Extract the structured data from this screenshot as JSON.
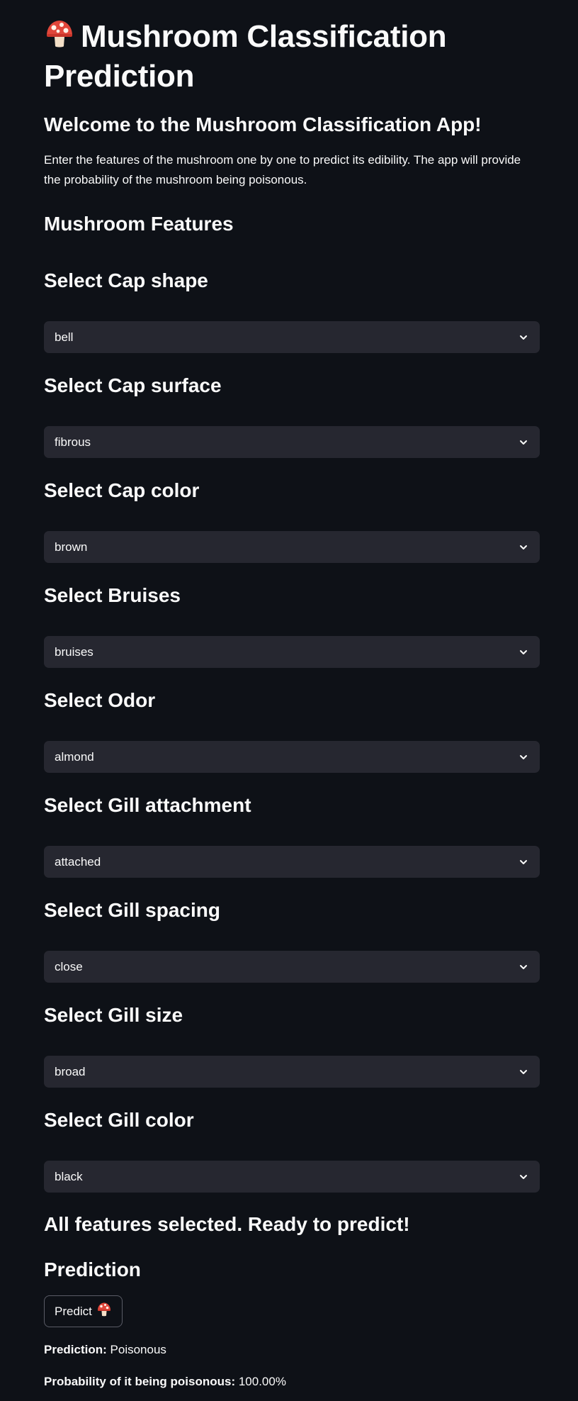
{
  "app": {
    "title_line": "Mushroom Classification Prediction",
    "welcome": "Welcome to the Mushroom Classification App!",
    "intro": "Enter the features of the mushroom one by one to predict its edibility. The app will provide the probability of the mushroom being poisonous.",
    "features_heading": "Mushroom Features"
  },
  "features": [
    {
      "label": "Select Cap shape",
      "value": "bell"
    },
    {
      "label": "Select Cap surface",
      "value": "fibrous"
    },
    {
      "label": "Select Cap color",
      "value": "brown"
    },
    {
      "label": "Select Bruises",
      "value": "bruises"
    },
    {
      "label": "Select Odor",
      "value": "almond"
    },
    {
      "label": "Select Gill attachment",
      "value": "attached"
    },
    {
      "label": "Select Gill spacing",
      "value": "close"
    },
    {
      "label": "Select Gill size",
      "value": "broad"
    },
    {
      "label": "Select Gill color",
      "value": "black"
    }
  ],
  "status": {
    "ready": "All features selected. Ready to predict!",
    "prediction_heading": "Prediction",
    "predict_button": "Predict"
  },
  "result": {
    "prediction_label": "Prediction:",
    "prediction_value": "Poisonous",
    "probability_label": "Probability of it being poisonous:",
    "probability_value": "100.00%"
  },
  "icons": {
    "title_icon": "mushroom-icon",
    "button_icon": "mushroom-icon",
    "select_icon": "chevron-down-icon"
  },
  "colors": {
    "background": "#0e1117",
    "select_bg": "#262730",
    "text": "#fafafa"
  }
}
